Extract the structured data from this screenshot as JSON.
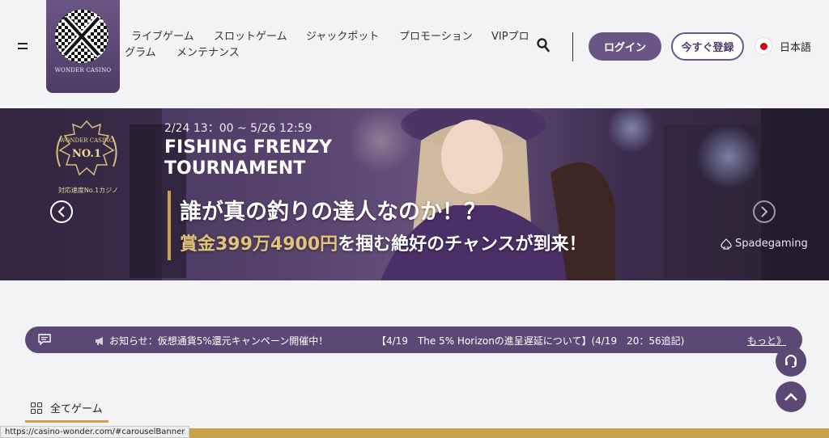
{
  "header": {
    "logo_text": "WONDER CASINO",
    "nav": [
      {
        "label": "ライブゲーム"
      },
      {
        "label": "スロットゲーム"
      },
      {
        "label": "ジャックポット"
      },
      {
        "label": "プロモーション"
      },
      {
        "label": "VIPプロ"
      },
      {
        "label": "グラム"
      },
      {
        "label": "メンテナンス"
      }
    ],
    "login_label": "ログイン",
    "register_label": "今すぐ登録",
    "language_label": "日本語"
  },
  "banner": {
    "badge_top": "WONDER CASINO",
    "badge_main": "NO.1",
    "badge_caption": "対応速度No.1カジノ",
    "date_range": "2/24 13：00 ~ 5/26 12:59",
    "title_line1": "FISHING FRENZY",
    "title_line2": "TOURNAMENT",
    "headline": "誰が真の釣りの達人なのか！？",
    "prize_amount": "賞金399万4900円",
    "prize_rest": "を掴む絶好のチャンスが到来！",
    "provider": "Spadegaming"
  },
  "notice": {
    "item1": "お知らせ：仮想通貨5%還元キャンペーン開催中！",
    "item2": "【4/19　The 5% Horizonの進呈遅延について】(4/19　20：56追記)",
    "more_label": "もっと》"
  },
  "section": {
    "all_games_label": "全てゲーム"
  },
  "status_bar": {
    "url": "https://casino-wonder.com/#carouselBanner"
  },
  "colors": {
    "brand_purple": "#6b5585",
    "notice_purple": "#5c4875",
    "gold": "#c9a24a",
    "page_bg": "#f3f2f5"
  }
}
